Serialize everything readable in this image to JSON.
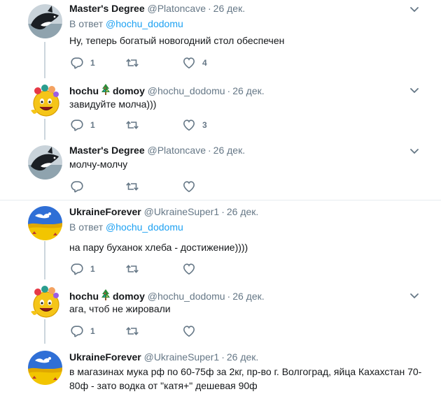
{
  "tweets": [
    {
      "name": "Master's Degree",
      "tree": false,
      "handle": "@Platoncave",
      "sep": "·",
      "date": "26 дек.",
      "reply_prefix": "В ответ",
      "reply_mention": "@hochu_dodomu",
      "text": "Ну, теперь богатый новогодний стол обеспечен",
      "replies": "1",
      "retweets": "",
      "likes": "4",
      "avatar": "orca-avatar"
    },
    {
      "name_a": "hochu",
      "name_b": "domoy",
      "tree": true,
      "handle": "@hochu_dodomu",
      "sep": "·",
      "date": "26 дек.",
      "text": "завидуйте  молча)))",
      "replies": "1",
      "retweets": "",
      "likes": "3",
      "avatar": "smiley-avatar"
    },
    {
      "name": "Master's Degree",
      "handle": "@Platoncave",
      "sep": "·",
      "date": "26 дек.",
      "text": "молчу-молчу",
      "replies": "",
      "retweets": "",
      "likes": "",
      "avatar": "orca-avatar"
    },
    {
      "name": "UkraineForever",
      "handle": "@UkraineSuper1",
      "sep": "·",
      "date": "26 дек.",
      "reply_prefix": "В ответ",
      "reply_mention": "@hochu_dodomu",
      "text": "на пару буханок хлеба - достижение))))",
      "replies": "1",
      "retweets": "",
      "likes": "",
      "avatar": "ukraine-avatar"
    },
    {
      "name_a": "hochu",
      "name_b": "domoy",
      "handle": "@hochu_dodomu",
      "sep": "·",
      "date": "26 дек.",
      "text": "ага,  чтоб  не  жировали",
      "replies": "1",
      "retweets": "",
      "likes": "",
      "avatar": "smiley-avatar"
    },
    {
      "name": "UkraineForever",
      "handle": "@UkraineSuper1",
      "sep": "·",
      "date": "26 дек.",
      "text_line1": "в магазинах мука рф по 60-75ф за 2кг, пр-во г. Волгоград, яйца Кахахстан 70-",
      "text_line2": "80ф - зато водка от \"катя+\" дешевая 90ф",
      "avatar": "ukraine-avatar"
    }
  ],
  "colors": {
    "accent": "#1da1f2",
    "secondary_text": "#657786",
    "divider": "#e6ecf0"
  }
}
